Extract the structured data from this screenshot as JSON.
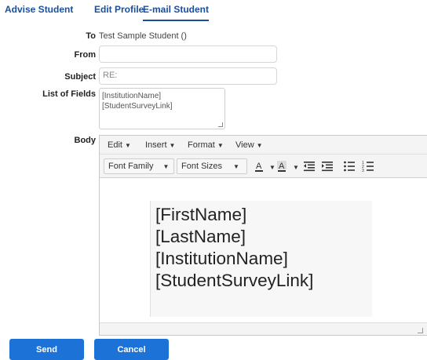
{
  "tabs": [
    {
      "label": "Advise Student"
    },
    {
      "label": "Edit Profile"
    },
    {
      "label": "E-mail Student",
      "active": true
    }
  ],
  "form": {
    "to_label": "To",
    "to_value": "Test Sample Student ()",
    "from_label": "From",
    "from_value": "",
    "subject_label": "Subject",
    "subject_value": "RE:",
    "fields_label": "List of Fields",
    "fields": [
      "[InstitutionName]",
      "[StudentSurveyLink]"
    ],
    "body_label": "Body"
  },
  "editor": {
    "menu": [
      "Edit",
      "Insert",
      "Format",
      "View"
    ],
    "toolbar": {
      "font_family": "Font Family",
      "font_sizes": "Font Sizes"
    },
    "content": [
      "[FirstName]",
      "[LastName]",
      "[InstitutionName]",
      "[StudentSurveyLink]"
    ]
  },
  "actions": {
    "send": "Send",
    "cancel": "Cancel"
  },
  "colors": {
    "link": "#1a4fa0",
    "button": "#1d72d8"
  }
}
